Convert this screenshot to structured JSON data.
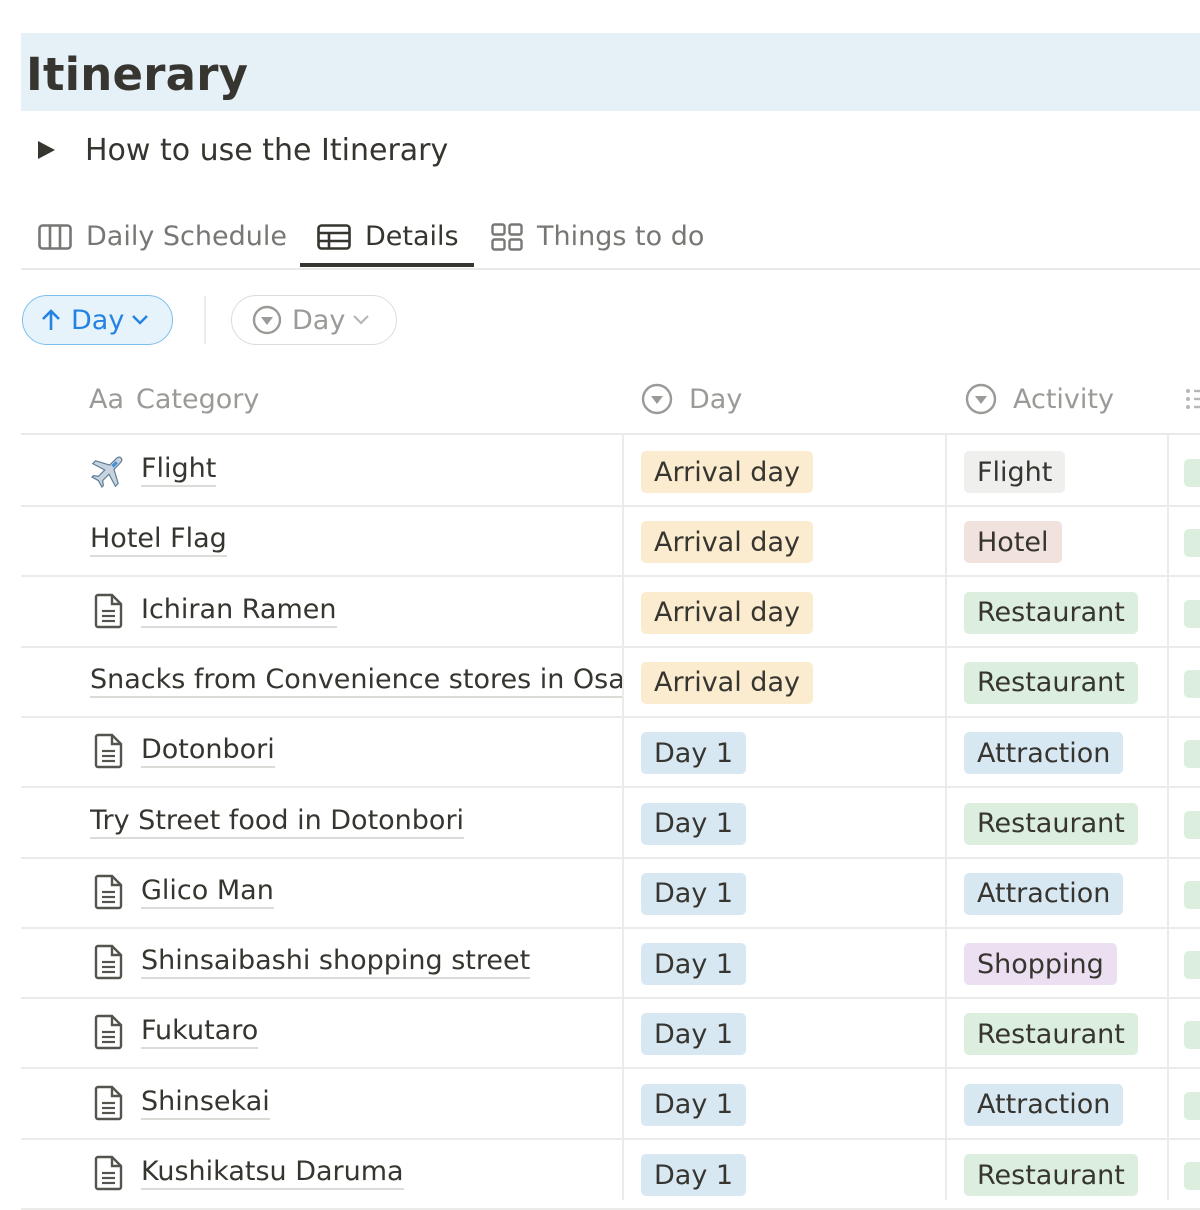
{
  "page": {
    "title": "Itinerary"
  },
  "toggle": {
    "label": "How to use the Itinerary"
  },
  "tabs": [
    {
      "label": "Daily Schedule",
      "icon": "columns-icon",
      "active": false
    },
    {
      "label": "Details",
      "icon": "table-icon",
      "active": true
    },
    {
      "label": "Things to do",
      "icon": "gallery-icon",
      "active": false
    }
  ],
  "toolbar": {
    "sort_label": "Day",
    "filter_label": "Day"
  },
  "table": {
    "columns": [
      {
        "label": "Category",
        "icon_text": "Aa"
      },
      {
        "label": "Day",
        "icon": "select-icon"
      },
      {
        "label": "Activity",
        "icon": "select-icon"
      }
    ],
    "rows": [
      {
        "name": "Flight",
        "icon": "airplane-icon",
        "day": "Arrival day",
        "activity": "Flight"
      },
      {
        "name": "Hotel Flag",
        "icon": "",
        "day": "Arrival day",
        "activity": "Hotel"
      },
      {
        "name": "Ichiran Ramen",
        "icon": "page-icon",
        "day": "Arrival day",
        "activity": "Restaurant"
      },
      {
        "name": "Snacks from Convenience stores in Osaka",
        "icon": "",
        "day": "Arrival day",
        "activity": "Restaurant"
      },
      {
        "name": "Dotonbori",
        "icon": "page-icon",
        "day": "Day 1",
        "activity": "Attraction"
      },
      {
        "name": "Try Street food in Dotonbori",
        "icon": "",
        "day": "Day 1",
        "activity": "Restaurant"
      },
      {
        "name": "Glico Man",
        "icon": "page-icon",
        "day": "Day 1",
        "activity": "Attraction"
      },
      {
        "name": "Shinsaibashi shopping street",
        "icon": "page-icon",
        "day": "Day 1",
        "activity": "Shopping"
      },
      {
        "name": "Fukutaro",
        "icon": "page-icon",
        "day": "Day 1",
        "activity": "Restaurant"
      },
      {
        "name": "Shinsekai",
        "icon": "page-icon",
        "day": "Day 1",
        "activity": "Attraction"
      },
      {
        "name": "Kushikatsu Daruma",
        "icon": "page-icon",
        "day": "Day 1",
        "activity": "Restaurant"
      }
    ]
  },
  "colors": {
    "title_bg": "#e5f0f7",
    "arrival_day": "#fbecd0",
    "day_1": "#d8e8f3",
    "flight": "#efefee",
    "hotel": "#f1e2dd",
    "restaurant": "#dcefdf",
    "attraction": "#d8e8f3",
    "shopping": "#ebdff1",
    "accent": "#2383e2"
  }
}
